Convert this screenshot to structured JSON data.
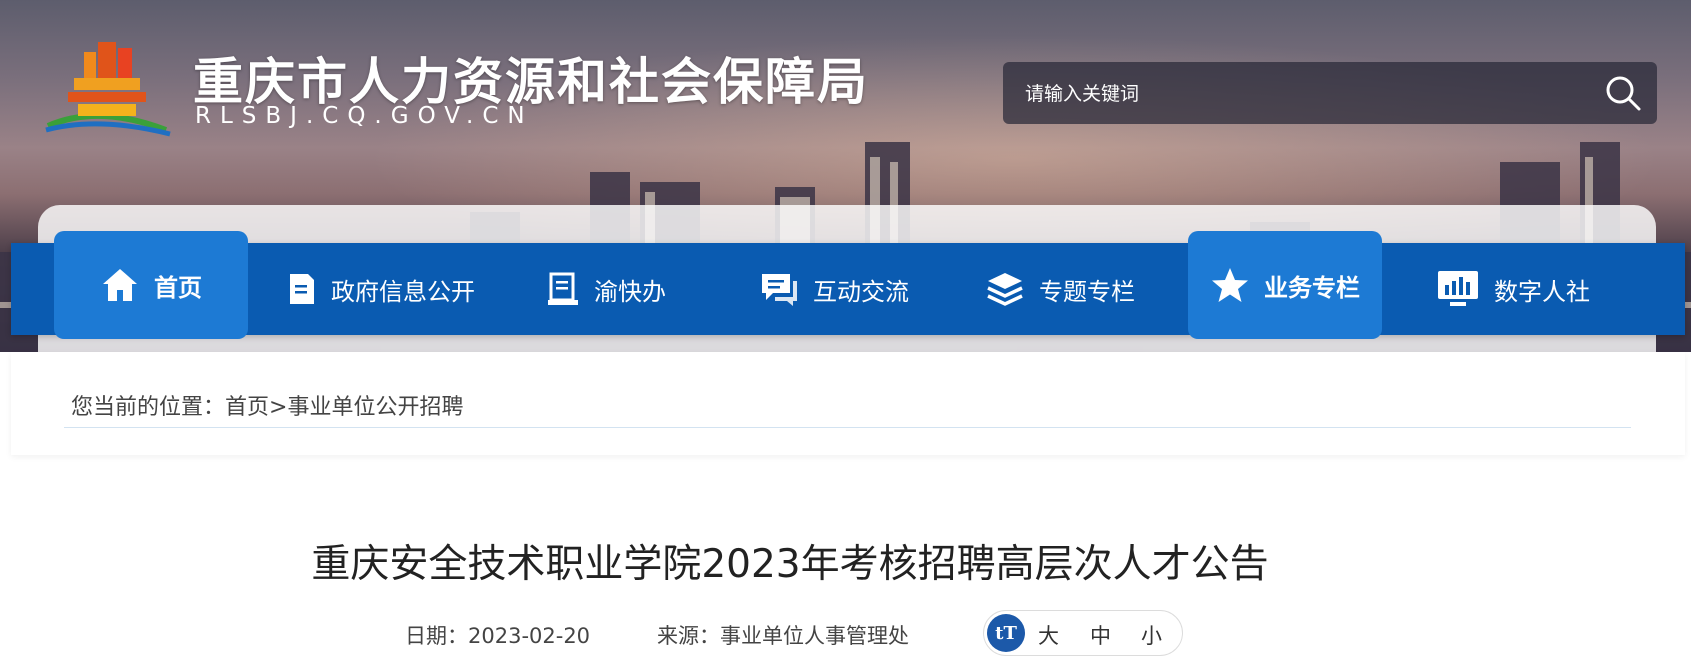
{
  "header": {
    "site_title": "重庆市人力资源和社会保障局",
    "site_domain": "RLSBJ.CQ.GOV.CN",
    "search_placeholder": "请输入关键词",
    "search_icon": "search-icon"
  },
  "nav": {
    "items": [
      {
        "label": "首页",
        "icon": "home-icon",
        "active": true
      },
      {
        "label": "政府信息公开",
        "icon": "document-icon",
        "active": false
      },
      {
        "label": "渝快办",
        "icon": "clipboard-icon",
        "active": false
      },
      {
        "label": "互动交流",
        "icon": "chat-icon",
        "active": false
      },
      {
        "label": "专题专栏",
        "icon": "layers-icon",
        "active": false
      },
      {
        "label": "业务专栏",
        "icon": "star-icon",
        "active": true
      },
      {
        "label": "数字人社",
        "icon": "monitor-chart-icon",
        "active": false
      }
    ]
  },
  "breadcrumb": {
    "prefix": "您当前的位置：",
    "home": "首页",
    "separator": ">",
    "current": "事业单位公开招聘"
  },
  "article": {
    "title": "重庆安全技术职业学院2023年考核招聘高层次人才公告",
    "date": "日期：2023-02-20",
    "source": "来源：事业单位人事管理处"
  },
  "font_size": {
    "icon_text": "tT",
    "large": "大",
    "medium": "中",
    "small": "小"
  },
  "colors": {
    "nav_blue": "#0a5bb1",
    "nav_active": "#1d7ad4",
    "tt_badge": "#1c59a9"
  }
}
